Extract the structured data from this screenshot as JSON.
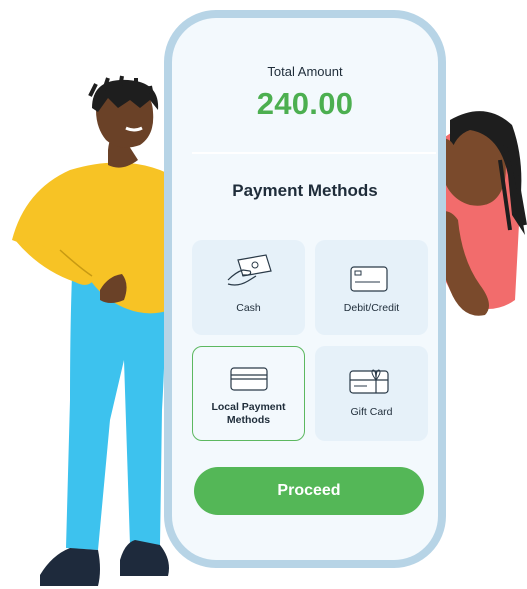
{
  "payment": {
    "total_label": "Total Amount",
    "total_value": "240.00",
    "methods_title": "Payment Methods",
    "methods": [
      {
        "label": "Cash",
        "icon": "cash-hand-icon"
      },
      {
        "label": "Debit/Credit",
        "icon": "credit-card-icon"
      },
      {
        "label": "Local Payment Methods",
        "icon": "wallet-card-icon",
        "selected": true
      },
      {
        "label": "Gift Card",
        "icon": "gift-card-icon"
      }
    ],
    "proceed_label": "Proceed"
  },
  "colors": {
    "accent_green": "#54b757",
    "amount_green": "#4caf50",
    "phone_frame": "#b7d4e6",
    "screen_bg": "#f3f9fd",
    "tile_bg": "#e6f1f9"
  }
}
